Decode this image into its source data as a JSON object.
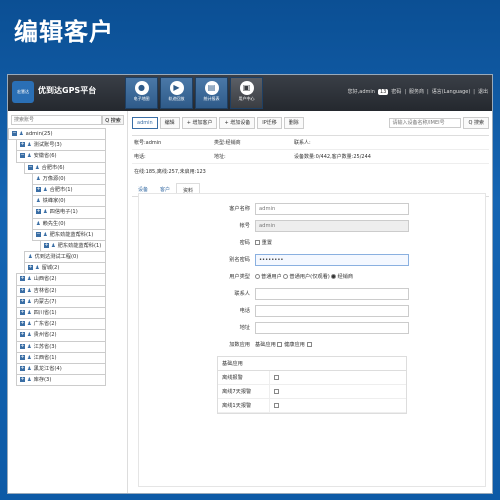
{
  "banner": {
    "title": "编辑客户"
  },
  "topbar": {
    "logo_text": "宏慧达",
    "platform_name": "优到达GPS平台",
    "nav": [
      {
        "label": "电子地图",
        "icon": "map-pin-icon",
        "glyph": "●"
      },
      {
        "label": "轨迹回放",
        "icon": "play-icon",
        "glyph": "▶"
      },
      {
        "label": "统计报表",
        "icon": "report-icon",
        "glyph": "▤"
      },
      {
        "label": "用户中心",
        "icon": "user-icon",
        "glyph": "▣"
      }
    ],
    "greeting": "您好,admin",
    "count": "13",
    "links": [
      "密码",
      "服务商",
      "语言(Language)",
      "退出"
    ]
  },
  "sidebar": {
    "search_placeholder": "搜索账号",
    "search_button": "Q 搜索",
    "tree": [
      {
        "toggle": "−",
        "label": "admin(25)",
        "indent": 0
      },
      {
        "toggle": "+",
        "label": "测试账号(3)",
        "indent": 1
      },
      {
        "toggle": "−",
        "label": "安徽省(6)",
        "indent": 1
      },
      {
        "toggle": "−",
        "label": "合肥市(6)",
        "indent": 2
      },
      {
        "toggle": "",
        "label": "万像源(0)",
        "indent": 3
      },
      {
        "toggle": "+",
        "label": "合肥市(1)",
        "indent": 3
      },
      {
        "toggle": "",
        "label": "铁峰家(0)",
        "indent": 3
      },
      {
        "toggle": "+",
        "label": "四信电子(1)",
        "indent": 3
      },
      {
        "toggle": "",
        "label": "赖先生(0)",
        "indent": 3
      },
      {
        "toggle": "−",
        "label": "肥东劲能蓝帮科(1)",
        "indent": 3
      },
      {
        "toggle": "+",
        "label": "肥东劲能蓝帮科(1)",
        "indent": 4
      },
      {
        "toggle": "",
        "label": "优到达测试工程(0)",
        "indent": 2
      },
      {
        "toggle": "+",
        "label": "留城(2)",
        "indent": 2
      },
      {
        "toggle": "+",
        "label": "山西省(2)",
        "indent": 1
      },
      {
        "toggle": "+",
        "label": "吉林省(2)",
        "indent": 1
      },
      {
        "toggle": "+",
        "label": "内蒙古(7)",
        "indent": 1
      },
      {
        "toggle": "+",
        "label": "四川省(1)",
        "indent": 1
      },
      {
        "toggle": "+",
        "label": "广东省(2)",
        "indent": 1
      },
      {
        "toggle": "+",
        "label": "贵州省(2)",
        "indent": 1
      },
      {
        "toggle": "+",
        "label": "江苏省(3)",
        "indent": 1
      },
      {
        "toggle": "+",
        "label": "江西省(1)",
        "indent": 1
      },
      {
        "toggle": "+",
        "label": "黑龙江省(4)",
        "indent": 1
      },
      {
        "toggle": "+",
        "label": "库存(3)",
        "indent": 1
      }
    ]
  },
  "toolbar": {
    "buttons": [
      "admin",
      "编辑",
      "+ 增加客户",
      "+ 增加设备",
      "IP迁移",
      "删除"
    ],
    "search_placeholder": "请输入设备名称/IMEI号",
    "search_button": "Q 搜索"
  },
  "info": {
    "row1": [
      "帐号:admin",
      "类型:经销商",
      "联系人:"
    ],
    "row2": [
      "电话:",
      "地址:",
      "设备数量:0/442,客户数量:25/244"
    ],
    "online": "在线:185,离线:257,未启用:123"
  },
  "tabs": [
    "设备",
    "客户",
    "资料"
  ],
  "form": {
    "customer_name": {
      "label": "客户名称",
      "value": "admin"
    },
    "account": {
      "label": "帐号",
      "value": "admin"
    },
    "password": {
      "label": "密码",
      "reset": "重置"
    },
    "alias": {
      "label": "别名密码",
      "value": "••••••••"
    },
    "user_type": {
      "label": "用户类型",
      "options": [
        "普通用户",
        "普通用户(仅观看)",
        "经销商"
      ],
      "selected": 2
    },
    "contact": {
      "label": "联系人"
    },
    "phone": {
      "label": "电话"
    },
    "address": {
      "label": "地址"
    },
    "extra_apps": {
      "label": "加数应用",
      "options": [
        "基础应用",
        "健康应用"
      ]
    },
    "base_apps_title": "基础应用",
    "base_apps": [
      "离线报警",
      "离线7天报警",
      "离线1天报警"
    ]
  }
}
